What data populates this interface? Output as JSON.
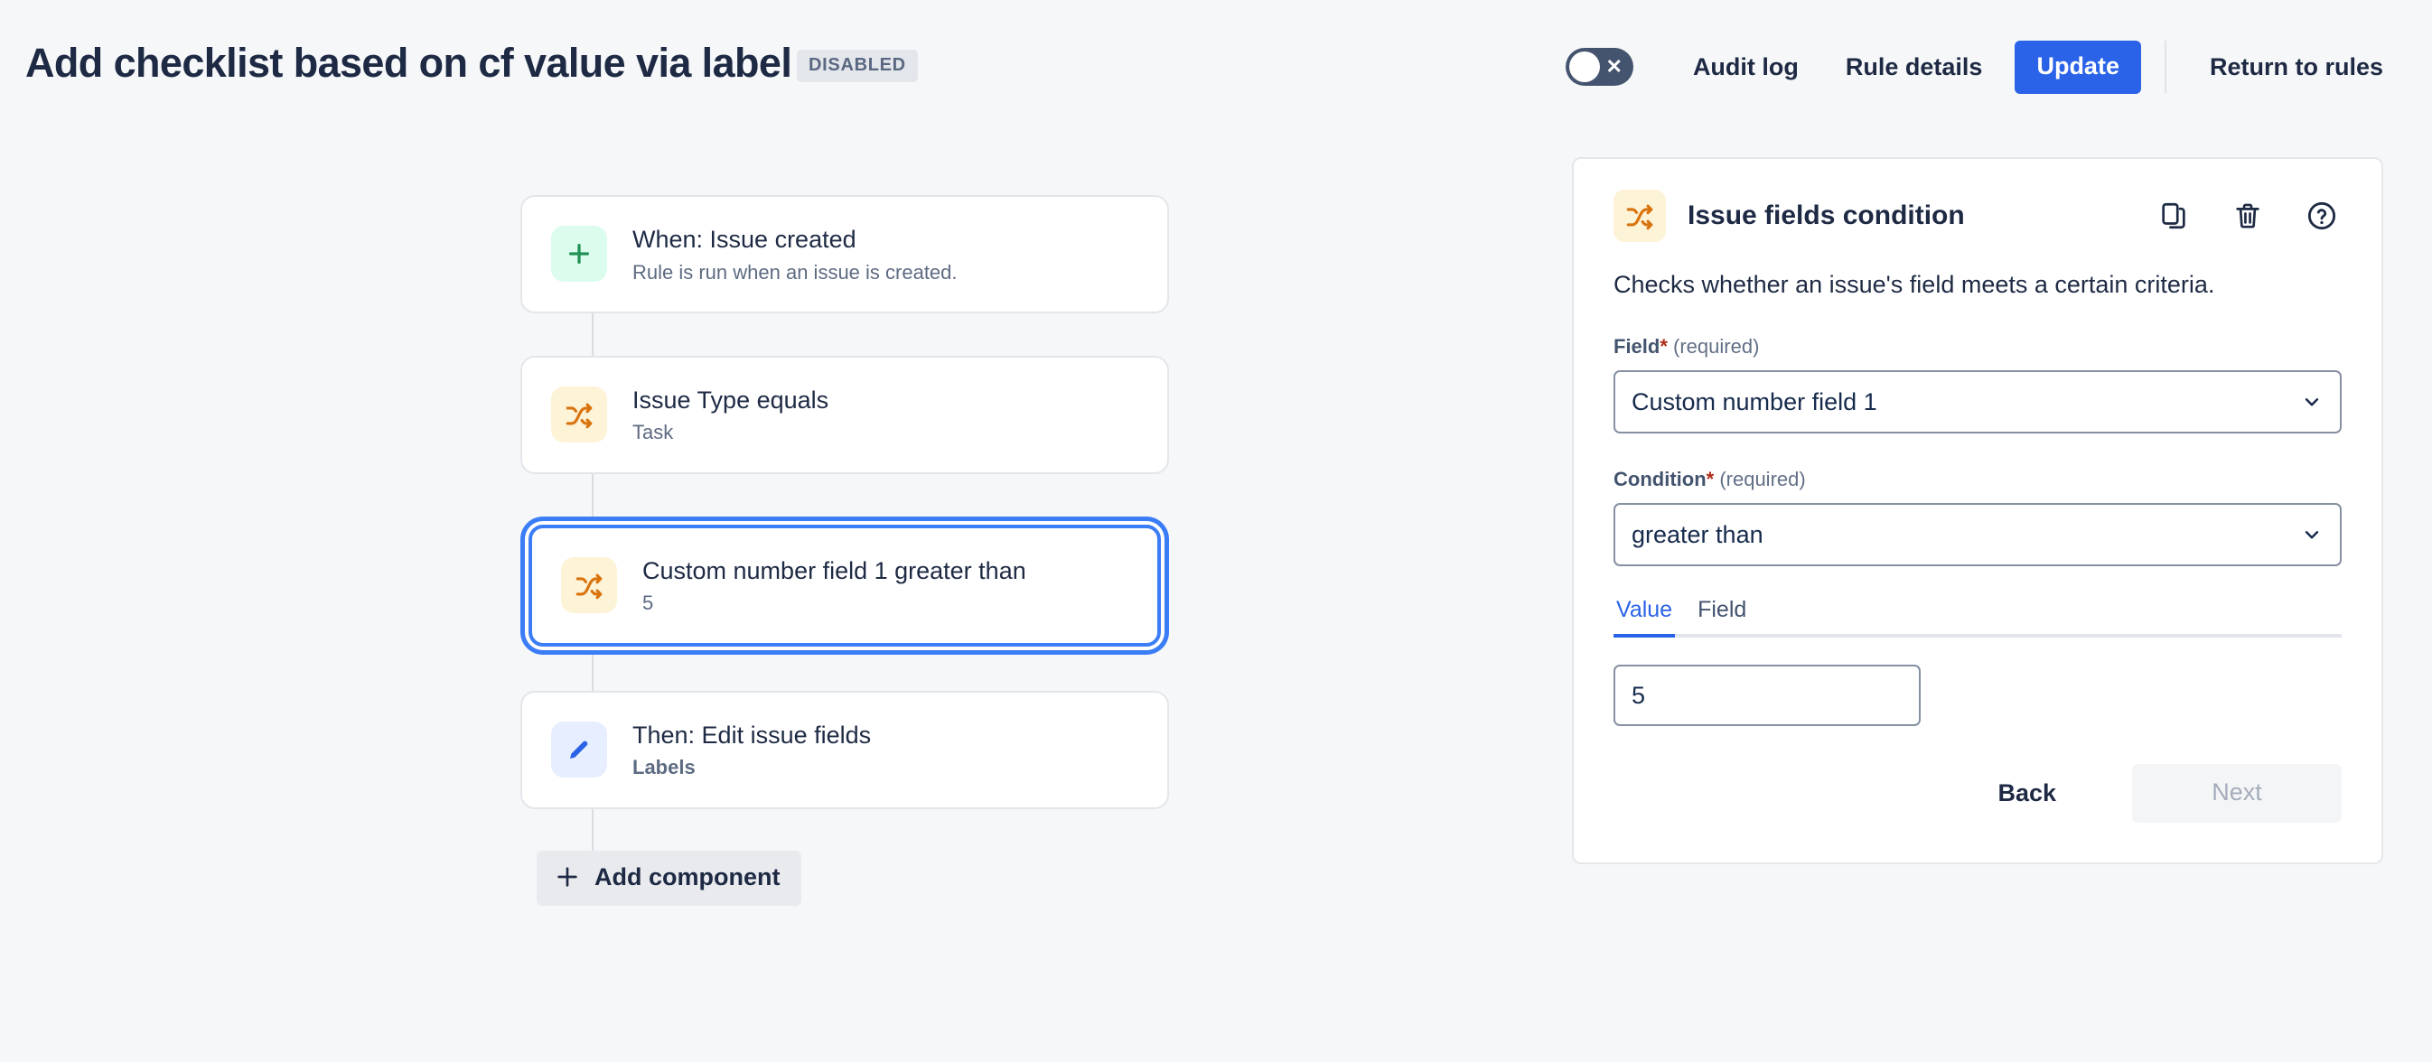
{
  "header": {
    "title": "Add checklist based on cf value via label",
    "status_badge": "DISABLED",
    "toggle": {
      "name": "rule-enabled-toggle",
      "state": "off",
      "mark": "✕"
    },
    "audit_log_label": "Audit log",
    "rule_details_label": "Rule details",
    "update_label": "Update",
    "return_label": "Return to rules",
    "accent_color": "#2b63e8",
    "toggle_off_color": "#44546f"
  },
  "flow": {
    "cards": [
      {
        "icon": "plus-icon",
        "icon_kind": "trigger",
        "title": "When: Issue created",
        "subtitle": "Rule is run when an issue is created.",
        "subtitle_strong": false,
        "selected": false
      },
      {
        "icon": "shuffle-icon",
        "icon_kind": "condition",
        "title": "Issue Type equals",
        "subtitle": "Task",
        "subtitle_strong": false,
        "selected": false
      },
      {
        "icon": "shuffle-icon",
        "icon_kind": "condition",
        "title": "Custom number field 1 greater than",
        "subtitle": "5",
        "subtitle_strong": false,
        "selected": true
      },
      {
        "icon": "pencil-icon",
        "icon_kind": "action",
        "title": "Then: Edit issue fields",
        "subtitle": "Labels",
        "subtitle_strong": true,
        "selected": false
      }
    ],
    "add_component_label": "Add component"
  },
  "panel": {
    "icon": "shuffle-icon",
    "title": "Issue fields condition",
    "description": "Checks whether an issue's field meets a certain criteria.",
    "tools": [
      {
        "name": "duplicate-icon",
        "label": "Duplicate"
      },
      {
        "name": "trash-icon",
        "label": "Delete"
      },
      {
        "name": "help-icon",
        "label": "Help"
      }
    ],
    "field": {
      "label": "Field",
      "required_star": "*",
      "required_text": "(required)",
      "value": "Custom number field 1"
    },
    "condition": {
      "label": "Condition",
      "required_star": "*",
      "required_text": "(required)",
      "value": "greater than"
    },
    "tabs": [
      {
        "label": "Value",
        "active": true
      },
      {
        "label": "Field",
        "active": false
      }
    ],
    "value_input": "5",
    "back_label": "Back",
    "next_label": "Next"
  }
}
